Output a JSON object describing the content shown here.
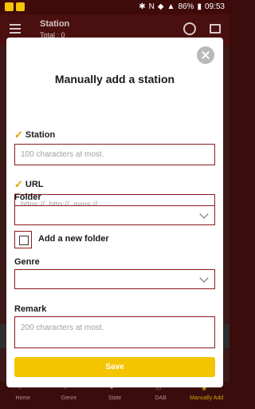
{
  "status_bar": {
    "battery": "86%",
    "time": "09:53"
  },
  "app_bar": {
    "title": "Station",
    "subtitle": "Total : 0"
  },
  "bottom_nav": [
    {
      "label": "Home"
    },
    {
      "label": "Genre"
    },
    {
      "label": "State"
    },
    {
      "label": "DAB"
    },
    {
      "label": "Manually Add"
    }
  ],
  "dialog": {
    "title": "Manually add a station",
    "station": {
      "label": "Station",
      "placeholder": "100 characters at most."
    },
    "url": {
      "label": "URL",
      "placeholder": "https://, http://, mms://..."
    },
    "folder": {
      "label": "Folder",
      "value": ""
    },
    "new_folder": {
      "label": "Add a new folder",
      "checked": false
    },
    "genre": {
      "label": "Genre",
      "value": ""
    },
    "remark": {
      "label": "Remark",
      "placeholder": "200 characters at most."
    },
    "save_label": "Save"
  },
  "colors": {
    "accent": "#f5c400",
    "border": "#8b1a1a",
    "check": "#e0a100"
  }
}
